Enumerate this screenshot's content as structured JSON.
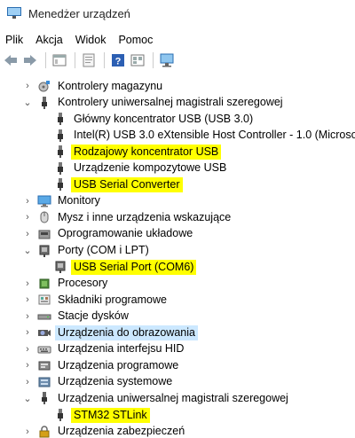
{
  "window": {
    "title": "Menedżer urządzeń"
  },
  "menu": [
    "Plik",
    "Akcja",
    "Widok",
    "Pomoc"
  ],
  "toolbar": [
    {
      "name": "back-icon"
    },
    {
      "name": "forward-icon"
    },
    {
      "name": "properties-icon"
    },
    {
      "name": "update-driver-icon"
    },
    {
      "name": "help-icon"
    },
    {
      "name": "view-icon"
    },
    {
      "name": "scan-hardware-icon"
    }
  ],
  "tree": [
    {
      "label": "Kontrolery magazynu",
      "level": 0,
      "expander": "›",
      "icon": "storage-controller-icon",
      "highlight": false,
      "selected": false
    },
    {
      "label": "Kontrolery uniwersalnej magistrali szeregowej",
      "level": 0,
      "expander": "⌄",
      "icon": "usb-controller-icon",
      "highlight": false,
      "selected": false
    },
    {
      "label": "Główny koncentrator USB (USB 3.0)",
      "level": 1,
      "expander": "",
      "icon": "usb-device-icon",
      "highlight": false,
      "selected": false
    },
    {
      "label": "Intel(R) USB 3.0 eXtensible Host Controller - 1.0 (Microsoft)",
      "level": 1,
      "expander": "",
      "icon": "usb-device-icon",
      "highlight": false,
      "selected": false
    },
    {
      "label": "Rodzajowy koncentrator USB",
      "level": 1,
      "expander": "",
      "icon": "usb-device-icon",
      "highlight": true,
      "selected": false
    },
    {
      "label": "Urządzenie kompozytowe USB",
      "level": 1,
      "expander": "",
      "icon": "usb-device-icon",
      "highlight": false,
      "selected": false
    },
    {
      "label": "USB Serial Converter",
      "level": 1,
      "expander": "",
      "icon": "usb-device-icon",
      "highlight": true,
      "selected": false
    },
    {
      "label": "Monitory",
      "level": 0,
      "expander": "›",
      "icon": "monitor-icon",
      "highlight": false,
      "selected": false
    },
    {
      "label": "Mysz i inne urządzenia wskazujące",
      "level": 0,
      "expander": "›",
      "icon": "mouse-icon",
      "highlight": false,
      "selected": false
    },
    {
      "label": "Oprogramowanie układowe",
      "level": 0,
      "expander": "›",
      "icon": "firmware-icon",
      "highlight": false,
      "selected": false
    },
    {
      "label": "Porty (COM i LPT)",
      "level": 0,
      "expander": "⌄",
      "icon": "port-icon",
      "highlight": false,
      "selected": false
    },
    {
      "label": "USB Serial Port (COM6)",
      "level": 1,
      "expander": "",
      "icon": "port-icon",
      "highlight": true,
      "selected": false
    },
    {
      "label": "Procesory",
      "level": 0,
      "expander": "›",
      "icon": "processor-icon",
      "highlight": false,
      "selected": false
    },
    {
      "label": "Składniki programowe",
      "level": 0,
      "expander": "›",
      "icon": "software-component-icon",
      "highlight": false,
      "selected": false
    },
    {
      "label": "Stacje dysków",
      "level": 0,
      "expander": "›",
      "icon": "disk-drive-icon",
      "highlight": false,
      "selected": false
    },
    {
      "label": "Urządzenia do obrazowania",
      "level": 0,
      "expander": "›",
      "icon": "camera-icon",
      "highlight": false,
      "selected": true
    },
    {
      "label": "Urządzenia interfejsu HID",
      "level": 0,
      "expander": "›",
      "icon": "hid-icon",
      "highlight": false,
      "selected": false
    },
    {
      "label": "Urządzenia programowe",
      "level": 0,
      "expander": "›",
      "icon": "software-device-icon",
      "highlight": false,
      "selected": false
    },
    {
      "label": "Urządzenia systemowe",
      "level": 0,
      "expander": "›",
      "icon": "system-device-icon",
      "highlight": false,
      "selected": false
    },
    {
      "label": "Urządzenia uniwersalnej magistrali szeregowej",
      "level": 0,
      "expander": "⌄",
      "icon": "usb-controller-icon",
      "highlight": false,
      "selected": false
    },
    {
      "label": "STM32 STLink",
      "level": 1,
      "expander": "",
      "icon": "usb-device-icon",
      "highlight": true,
      "selected": false
    },
    {
      "label": "Urządzenia zabezpieczeń",
      "level": 0,
      "expander": "›",
      "icon": "security-device-icon",
      "highlight": false,
      "selected": false
    }
  ]
}
